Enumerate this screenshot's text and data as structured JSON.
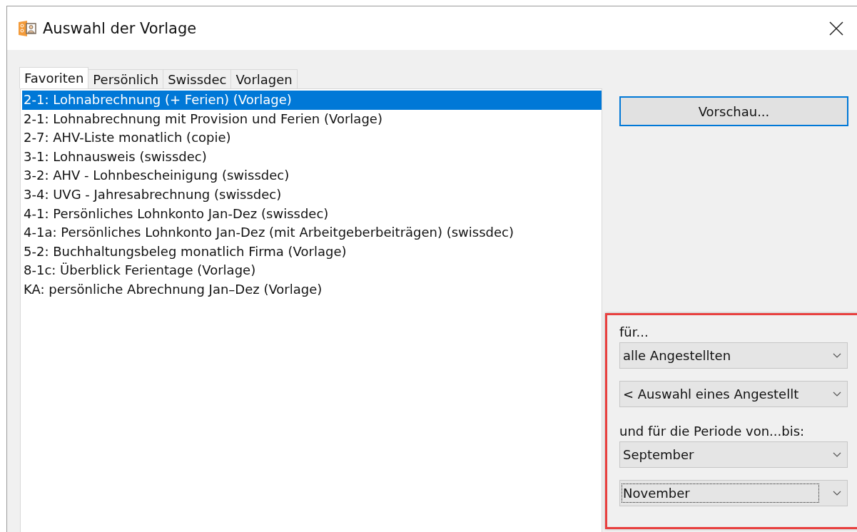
{
  "window": {
    "title": "Auswahl der Vorlage"
  },
  "tabs": [
    {
      "label": "Favoriten",
      "selected": true
    },
    {
      "label": "Persönlich",
      "selected": false
    },
    {
      "label": "Swissdec",
      "selected": false
    },
    {
      "label": "Vorlagen",
      "selected": false
    }
  ],
  "templates": [
    {
      "label": "2-1: Lohnabrechnung (+ Ferien) (Vorlage)",
      "selected": true
    },
    {
      "label": "2-1: Lohnabrechnung mit Provision und Ferien (Vorlage)",
      "selected": false
    },
    {
      "label": "2-7: AHV-Liste monatlich (copie)",
      "selected": false
    },
    {
      "label": "3-1: Lohnausweis (swissdec)",
      "selected": false
    },
    {
      "label": "3-2: AHV - Lohnbescheinigung (swissdec)",
      "selected": false
    },
    {
      "label": "3-4: UVG - Jahresabrechnung (swissdec)",
      "selected": false
    },
    {
      "label": "4-1: Persönliches Lohnkonto Jan-Dez (swissdec)",
      "selected": false
    },
    {
      "label": "4-1a: Persönliches Lohnkonto Jan-Dez (mit Arbeitgeberbeiträgen) (swissdec)",
      "selected": false
    },
    {
      "label": "5-2: Buchhaltungsbeleg monatlich Firma (Vorlage)",
      "selected": false
    },
    {
      "label": "8-1c: Überblick Ferientage (Vorlage)",
      "selected": false
    },
    {
      "label": "KA: persönliche Abrechnung Jan–Dez (Vorlage)",
      "selected": false
    }
  ],
  "preview_button": "Vorschau...",
  "filters": [
    {
      "kind": "label",
      "text": "für..."
    },
    {
      "kind": "dropdown",
      "value": "alle Angestellten",
      "focused": false
    },
    {
      "kind": "dropdown",
      "value": "< Auswahl eines Angestellt",
      "focused": false
    },
    {
      "kind": "label",
      "text": "und für die Periode von...bis:"
    },
    {
      "kind": "dropdown",
      "value": "September",
      "focused": false
    },
    {
      "kind": "dropdown",
      "value": "November",
      "focused": true
    }
  ]
}
